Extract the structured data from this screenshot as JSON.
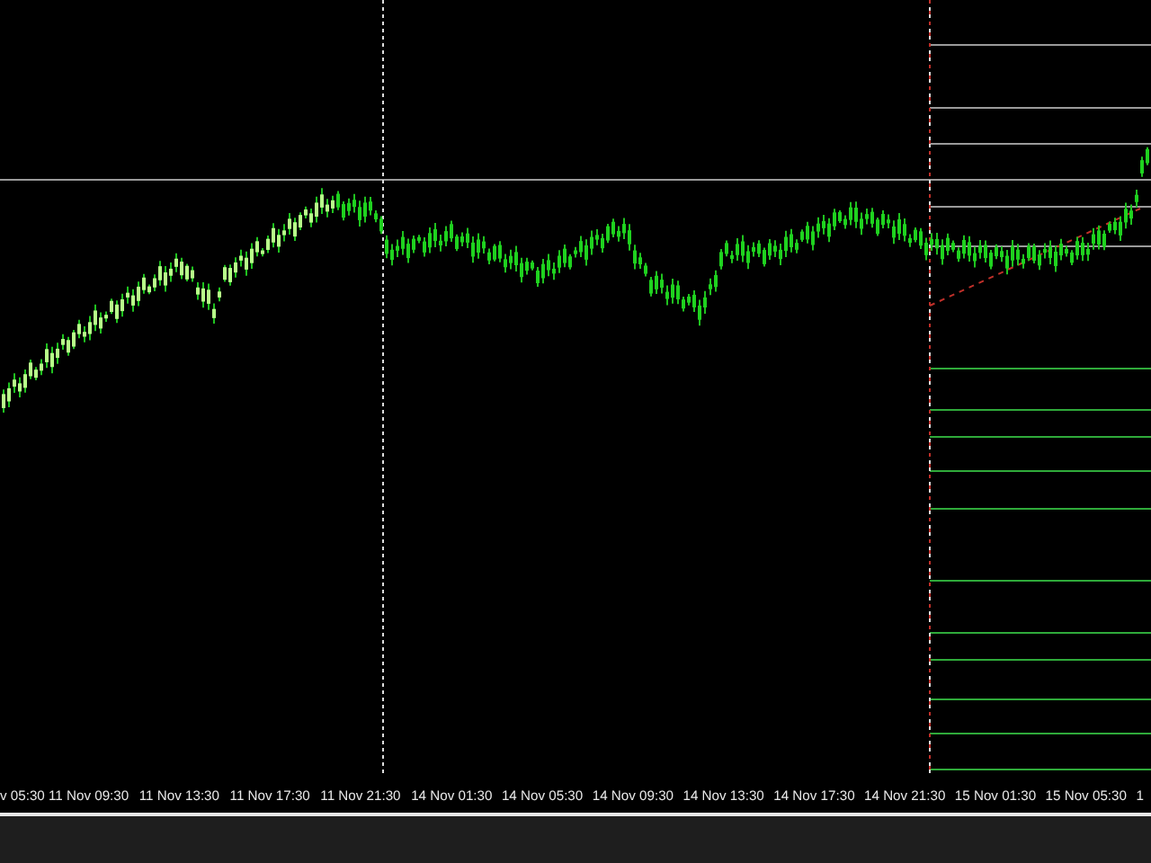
{
  "time_axis": {
    "labels": [
      "v 05:30",
      "11 Nov 09:30",
      "11 Nov 13:30",
      "11 Nov 17:30",
      "11 Nov 21:30",
      "14 Nov 01:30",
      "14 Nov 05:30",
      "14 Nov 09:30",
      "14 Nov 13:30",
      "14 Nov 17:30",
      "14 Nov 21:30",
      "15 Nov 01:30",
      "15 Nov 05:30",
      "1"
    ]
  }
}
